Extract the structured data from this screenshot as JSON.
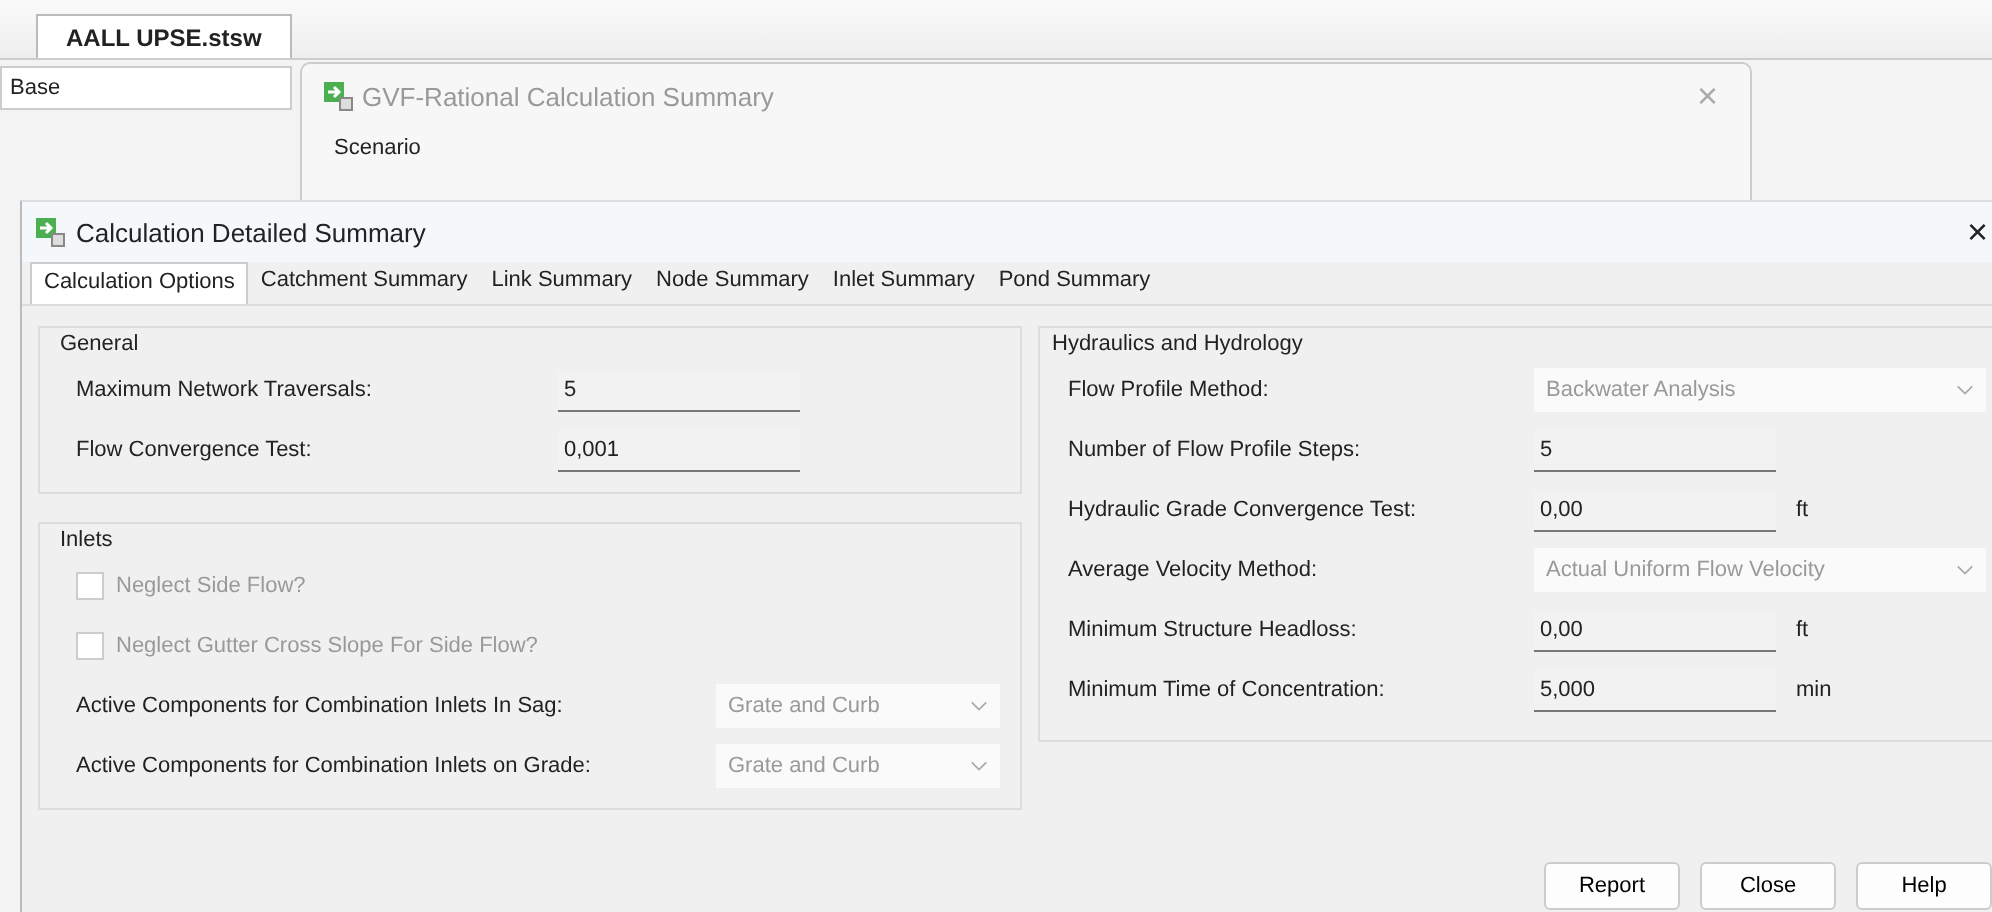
{
  "document_tab": {
    "label": "AALL UPSE.stsw",
    "selected": true
  },
  "scenario_field": {
    "value": "Base"
  },
  "background_dialog": {
    "title": "GVF-Rational Calculation Summary",
    "close": "×",
    "section_label": "Scenario"
  },
  "dialog": {
    "title": "Calculation Detailed Summary",
    "close": "×",
    "tabs": [
      {
        "label": "Calculation Options",
        "selected": true
      },
      {
        "label": "Catchment Summary",
        "selected": false
      },
      {
        "label": "Link Summary",
        "selected": false
      },
      {
        "label": "Node Summary",
        "selected": false
      },
      {
        "label": "Inlet Summary",
        "selected": false
      },
      {
        "label": "Pond Summary",
        "selected": false
      }
    ],
    "left_groups": [
      {
        "title": "General",
        "rows": [
          {
            "kind": "text",
            "label": "Maximum Network Traversals:",
            "value": "5"
          },
          {
            "kind": "text",
            "label": "Flow Convergence Test:",
            "value": "0,001"
          }
        ]
      },
      {
        "title": "Inlets",
        "rows": [
          {
            "kind": "checkbox",
            "label": "Neglect Side Flow?",
            "checked": false,
            "disabled": true
          },
          {
            "kind": "checkbox",
            "label": "Neglect Gutter Cross Slope For Side Flow?",
            "checked": false,
            "disabled": true
          },
          {
            "kind": "dropdown",
            "label": "Active Components for Combination Inlets In Sag:",
            "value": "Grate and Curb",
            "disabled": true
          },
          {
            "kind": "dropdown",
            "label": "Active Components for Combination Inlets on Grade:",
            "value": "Grate and Curb",
            "disabled": true
          }
        ]
      }
    ],
    "right_group": {
      "title": "Hydraulics and Hydrology",
      "rows": [
        {
          "kind": "dropdown",
          "label": "Flow Profile Method:",
          "value": "Backwater Analysis",
          "disabled": true
        },
        {
          "kind": "text",
          "label": "Number of Flow Profile Steps:",
          "value": "5"
        },
        {
          "kind": "text",
          "label": "Hydraulic Grade Convergence Test:",
          "value": "0,00",
          "unit": "ft"
        },
        {
          "kind": "dropdown",
          "label": "Average Velocity Method:",
          "value": "Actual Uniform Flow Velocity",
          "disabled": true
        },
        {
          "kind": "text",
          "label": "Minimum Structure Headloss:",
          "value": "0,00",
          "unit": "ft"
        },
        {
          "kind": "text",
          "label": "Minimum Time of Concentration:",
          "value": "5,000",
          "unit": "min"
        }
      ]
    },
    "buttons": [
      "Report",
      "Close",
      "Help"
    ]
  }
}
